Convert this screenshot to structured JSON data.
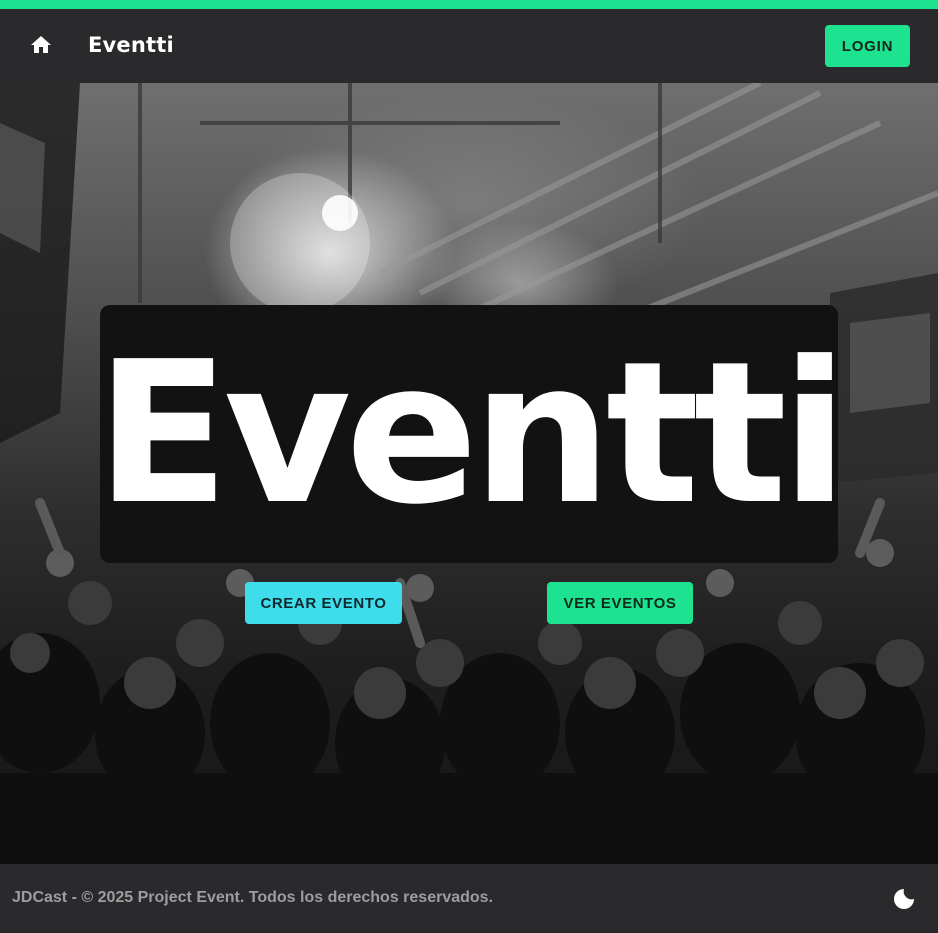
{
  "colors": {
    "accent_green": "#1de28f",
    "accent_cyan": "#3fdcec",
    "navbar_bg": "#2a2a2c",
    "logo_box_bg": "#121212",
    "footer_text": "#9d9d9f"
  },
  "navbar": {
    "home_icon": "home-icon",
    "brand": "Eventti",
    "login_label": "LOGIN"
  },
  "hero": {
    "logo_text": "Eventti",
    "create_event_label": "CREAR EVENTO",
    "view_events_label": "VER EVENTOS"
  },
  "footer": {
    "copyright": "JDCast - © 2025 Project Event. Todos los derechos reservados.",
    "theme_icon": "moon-icon"
  }
}
